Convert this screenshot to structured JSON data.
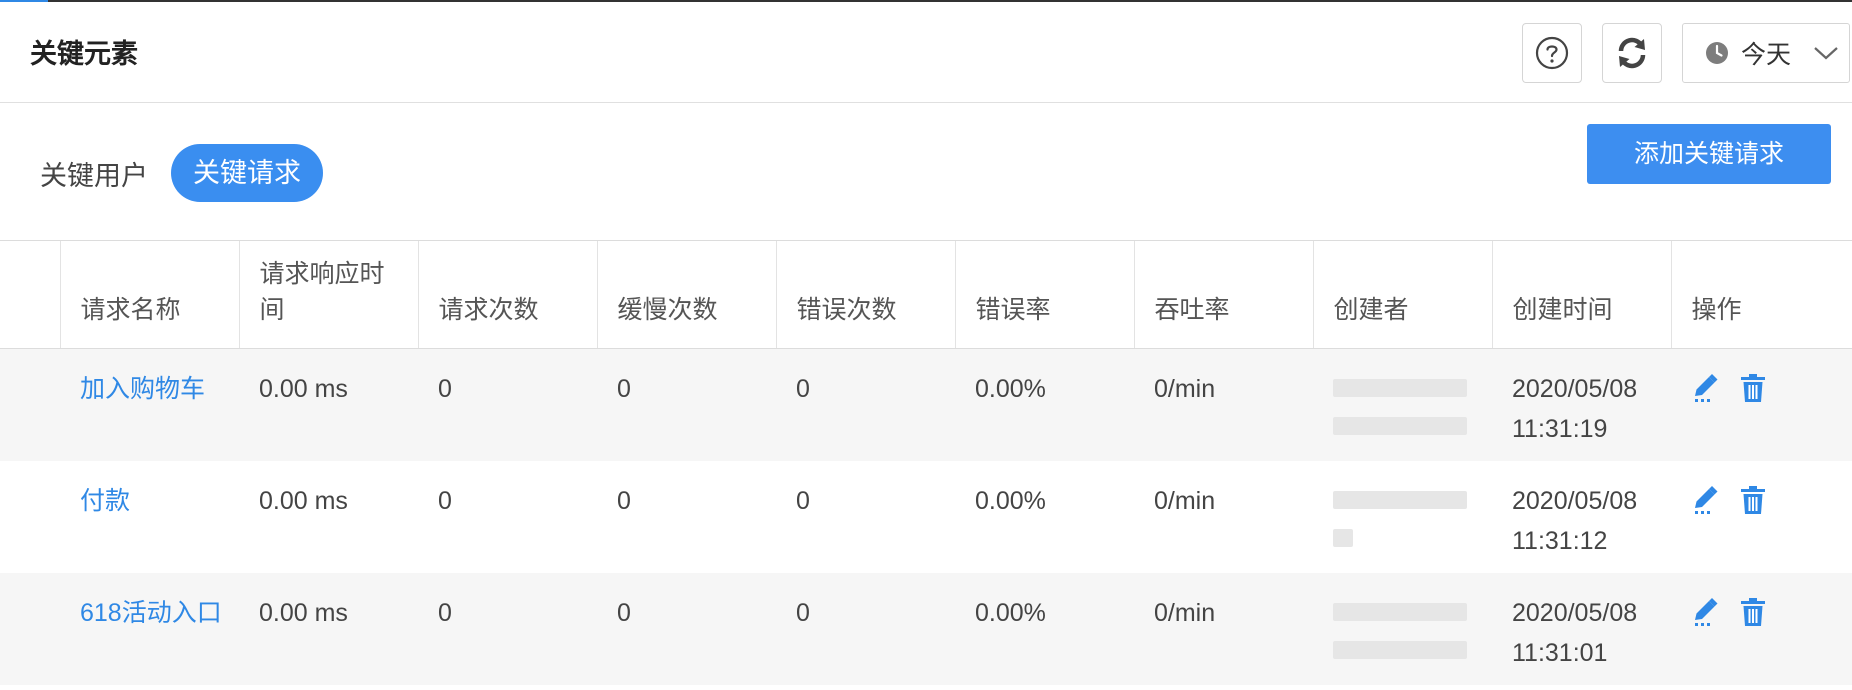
{
  "header": {
    "title": "关键元素",
    "date_range": "今天",
    "icons": {
      "help": "help-circle-icon",
      "refresh": "refresh-icon",
      "clock": "clock-icon",
      "dropdown": "chevron-down-icon"
    }
  },
  "tabs": [
    {
      "label": "关键用户",
      "active": false
    },
    {
      "label": "关键请求",
      "active": true
    }
  ],
  "add_button": "添加关键请求",
  "colors": {
    "accent": "#3a8ef0",
    "link": "#2f88e5",
    "row_alt": "#f6f6f6"
  },
  "table": {
    "columns": [
      "",
      "请求名称",
      "请求响应时间",
      "请求次数",
      "缓慢次数",
      "错误次数",
      "错误率",
      "吞吐率",
      "创建者",
      "创建时间",
      "操作"
    ],
    "rows": [
      {
        "name": "加入购物车",
        "response_time": "0.00 ms",
        "requests": "0",
        "slow": "0",
        "errors": "0",
        "error_rate": "0.00%",
        "throughput": "0/min",
        "creator": "",
        "created_date": "2020/05/08",
        "created_time": "11:31:19"
      },
      {
        "name": "付款",
        "response_time": "0.00 ms",
        "requests": "0",
        "slow": "0",
        "errors": "0",
        "error_rate": "0.00%",
        "throughput": "0/min",
        "creator": "",
        "created_date": "2020/05/08",
        "created_time": "11:31:12"
      },
      {
        "name": "618活动入口",
        "response_time": "0.00 ms",
        "requests": "0",
        "slow": "0",
        "errors": "0",
        "error_rate": "0.00%",
        "throughput": "0/min",
        "creator": "",
        "created_date": "2020/05/08",
        "created_time": "11:31:01"
      }
    ],
    "row_actions": [
      "edit-icon",
      "delete-icon"
    ]
  }
}
